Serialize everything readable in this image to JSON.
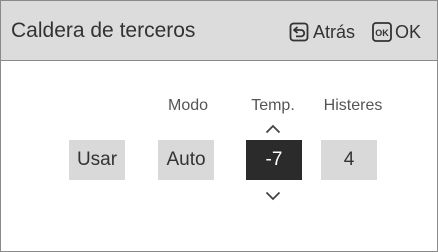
{
  "header": {
    "title": "Caldera de terceros",
    "back_label": "Atrás",
    "ok_icon_text": "OK",
    "ok_label": "OK"
  },
  "columns": {
    "mode_label": "Modo",
    "temp_label": "Temp.",
    "hysteresis_label": "Histeres"
  },
  "values": {
    "use": "Usar",
    "mode": "Auto",
    "temp": "-7",
    "hysteresis": "4"
  },
  "icons": {
    "back": "back-arrow-icon",
    "ok": "ok-key-icon",
    "up": "chevron-up-icon",
    "down": "chevron-down-icon"
  },
  "colors": {
    "header_bg": "#dcdcdc",
    "box_bg": "#d9d9d9",
    "selected_bg": "#2b2b2b"
  }
}
